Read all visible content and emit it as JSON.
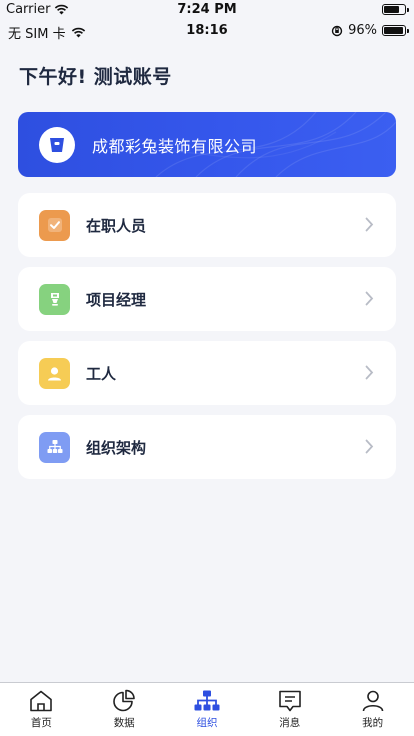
{
  "simulator_bar": {
    "carrier": "Carrier",
    "time": "7:24 PM"
  },
  "status_bar": {
    "carrier": "无 SIM 卡",
    "time": "18:16",
    "battery": "96%",
    "battery_level": 0.96
  },
  "greeting": "下午好! 测试账号",
  "company": {
    "name": "成都彩兔装饰有限公司",
    "accent": "#2e4fe0"
  },
  "menu": [
    {
      "label": "在职人员",
      "icon": "check-badge-icon",
      "color": "#ec9a4e"
    },
    {
      "label": "项目经理",
      "icon": "manager-badge-icon",
      "color": "#86d27f"
    },
    {
      "label": "工人",
      "icon": "worker-icon",
      "color": "#f6cc55"
    },
    {
      "label": "组织架构",
      "icon": "org-chart-icon",
      "color": "#7f9cf3"
    }
  ],
  "tabbar": {
    "tabs": [
      {
        "label": "首页",
        "icon": "home-icon"
      },
      {
        "label": "数据",
        "icon": "pie-chart-icon"
      },
      {
        "label": "组织",
        "icon": "org-chart-icon"
      },
      {
        "label": "消息",
        "icon": "message-icon"
      },
      {
        "label": "我的",
        "icon": "profile-icon"
      }
    ],
    "active": "组织",
    "active_color": "#2e4fe0"
  }
}
